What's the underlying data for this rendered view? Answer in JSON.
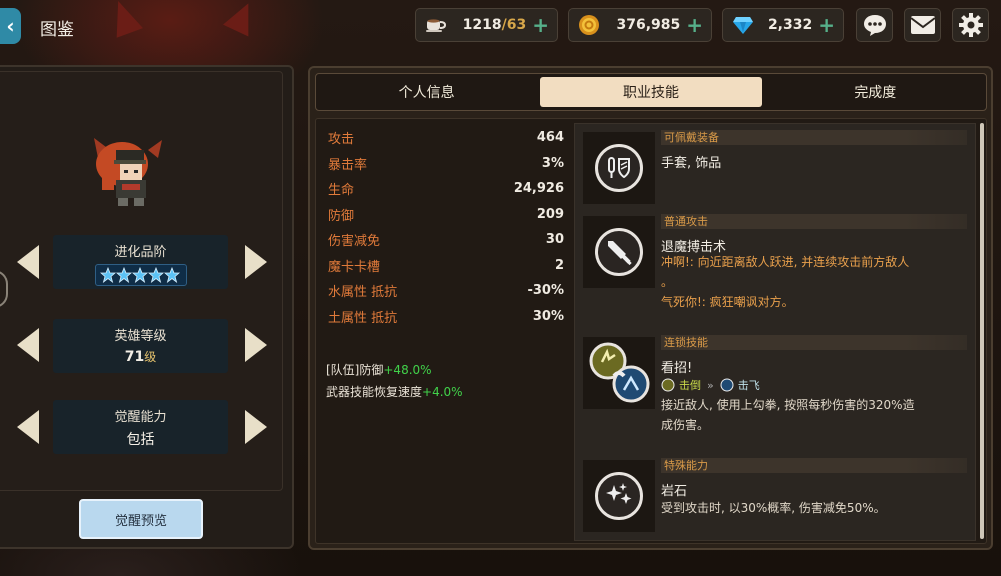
{
  "header": {
    "back_icon": "back-arrow-icon",
    "title": "图鉴"
  },
  "resources": {
    "stamina": {
      "icon": "coffee-cup-icon",
      "value": "1218",
      "max": "/63"
    },
    "gold": {
      "icon": "gold-coin-icon",
      "value": "376,985"
    },
    "gems": {
      "icon": "diamond-icon",
      "value": "2,332"
    }
  },
  "top_icons": [
    "chat-bubble-icon",
    "mail-icon",
    "settings-gear-icon"
  ],
  "left": {
    "evolution": {
      "label": "进化品阶",
      "stars": 5
    },
    "level": {
      "label": "英雄等级",
      "value": "71",
      "unit": "级"
    },
    "awaken": {
      "label": "觉醒能力",
      "value": "包括"
    },
    "preview_button": "觉醒预览"
  },
  "tabs": [
    {
      "label": "个人信息",
      "active": false
    },
    {
      "label": "职业技能",
      "active": true
    },
    {
      "label": "完成度",
      "active": false
    }
  ],
  "stats": [
    {
      "name": "攻击",
      "value": "464"
    },
    {
      "name": "暴击率",
      "value": "3%"
    },
    {
      "name": "生命",
      "value": "24,926"
    },
    {
      "name": "防御",
      "value": "209"
    },
    {
      "name": "伤害减免",
      "value": "30"
    },
    {
      "name": "魔卡卡槽",
      "value": "2"
    },
    {
      "name": "水属性  抵抗",
      "value": "-30%"
    },
    {
      "name": "土属性  抵抗",
      "value": "30%"
    }
  ],
  "bonuses": [
    {
      "text": "[队伍]防御",
      "value": "+48.0%"
    },
    {
      "text": "武器技能恢复速度",
      "value": "+4.0%"
    }
  ],
  "skills": {
    "equip": {
      "category": "可佩戴装备",
      "name": "手套, 饰品",
      "icon": "glove-accessory-icon"
    },
    "normal": {
      "category": "普通攻击",
      "name": "退魔搏击术",
      "desc1": "冲啊!: 向近距离敌人跃进, 并连续攻击前方敌人",
      "desc1b": "。",
      "desc2": "气死你!: 疯狂嘲讽对方。",
      "icon": "sword-icon"
    },
    "chain": {
      "category": "连锁技能",
      "name": "看招!",
      "from": "击倒",
      "to": "击飞",
      "desc1": "接近敌人, 使用上勾拳, 按照每秒伤害的320%造",
      "desc2": "成伤害。",
      "icon": "chain-link-icon"
    },
    "special": {
      "category": "特殊能力",
      "name": "岩石",
      "desc": "受到攻击时, 以30%概率, 伤害减免50%。",
      "icon": "sparkle-icon"
    }
  }
}
